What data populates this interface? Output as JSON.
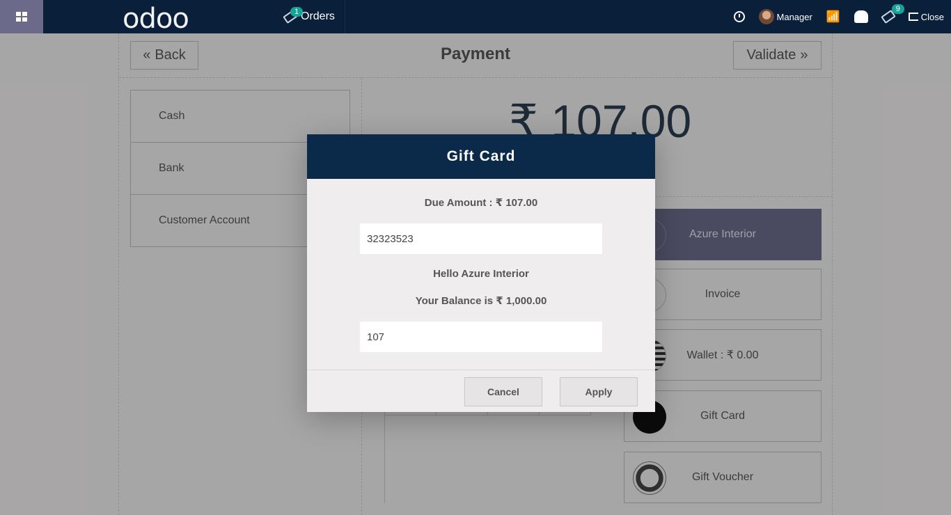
{
  "topbar": {
    "logo": "odoo",
    "orders_label": "Orders",
    "orders_count": "1",
    "user_name": "Manager",
    "tickets_count": "9",
    "close_label": "Close"
  },
  "payment": {
    "title": "Payment",
    "back_label": "Back",
    "validate_label": "Validate",
    "total": "₹ 107.00",
    "methods": [
      "Cash",
      "Bank",
      "Customer Account"
    ],
    "side_buttons": {
      "customer": "Azure Interior",
      "invoice": "Invoice",
      "wallet": "Wallet : ₹ 0.00",
      "gift_card": "Gift Card",
      "gift_voucher": "Gift Voucher"
    }
  },
  "modal": {
    "title": "Gift Card",
    "due_amount": "Due Amount : ₹ 107.00",
    "card_number": "32323523",
    "greeting": "Hello Azure Interior",
    "balance": "Your Balance is ₹ 1,000.00",
    "amount": "107",
    "cancel_label": "Cancel",
    "apply_label": "Apply"
  },
  "colors": {
    "topbar": "#0a1f3a",
    "accent": "#6b6a8a",
    "modal_header": "#0b2a4a",
    "badge": "#17a398"
  }
}
